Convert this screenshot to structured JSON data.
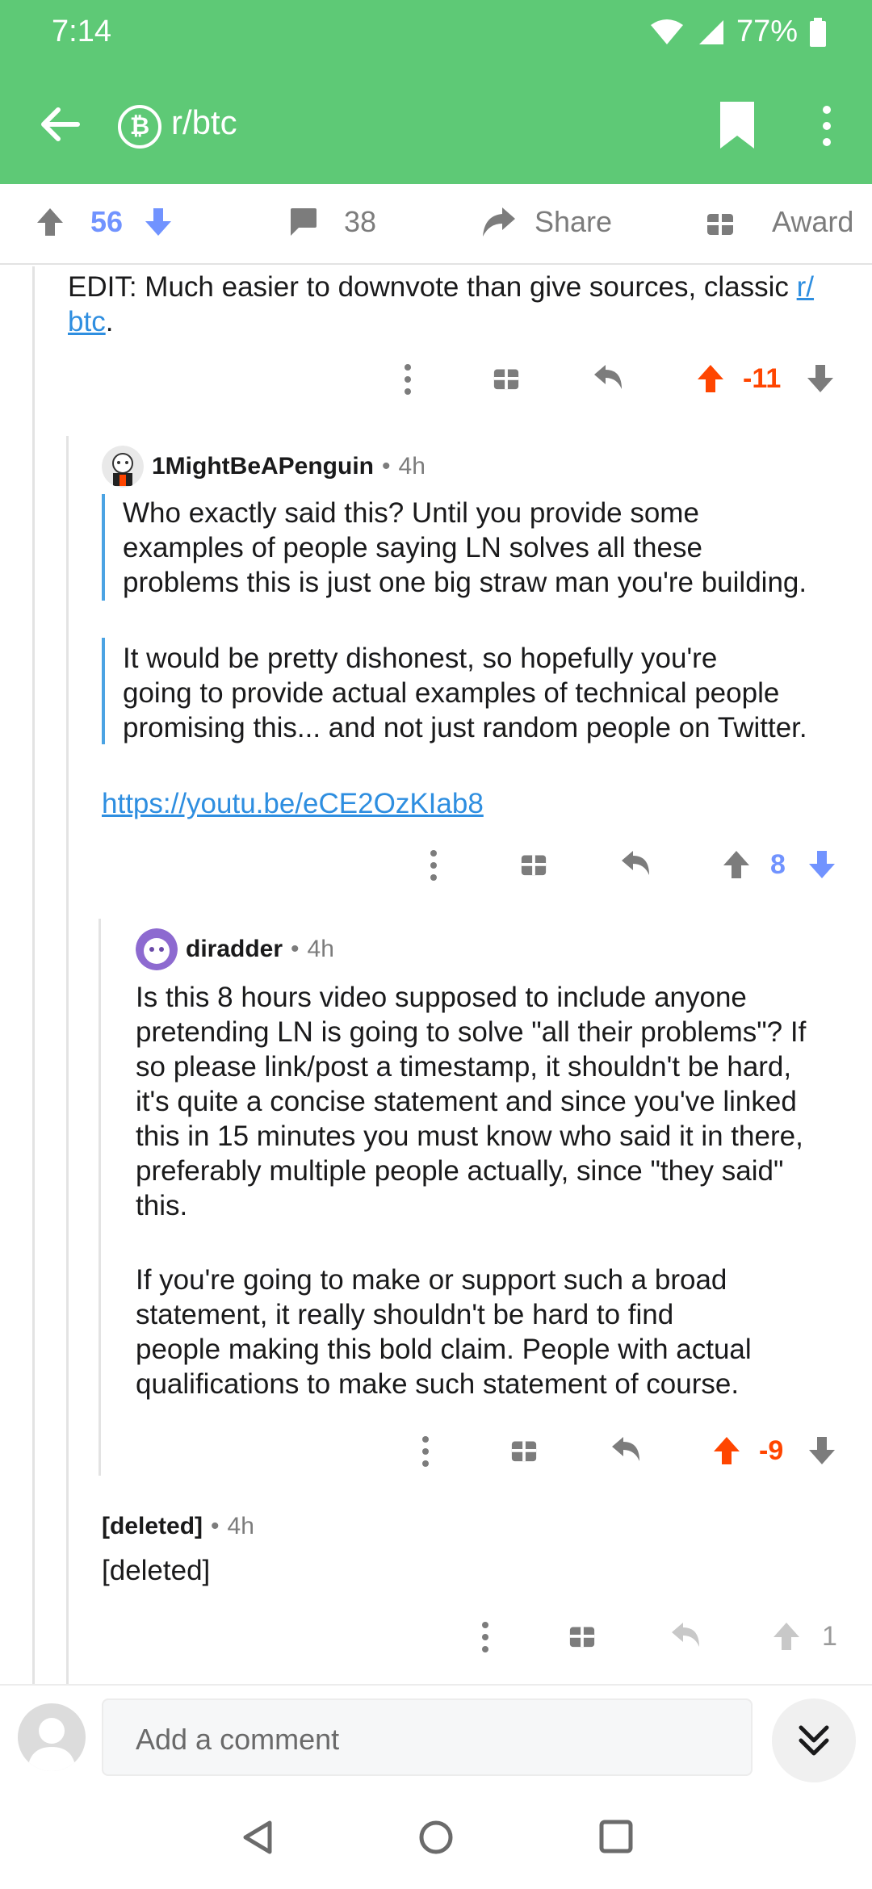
{
  "status": {
    "time": "7:14",
    "battery": "77%"
  },
  "appbar": {
    "subreddit": "r/btc",
    "sub_icon_letter": "₿"
  },
  "post_actions": {
    "score": "56",
    "comments": "38",
    "share": "Share",
    "award": "Award"
  },
  "comments": [
    {
      "text_before_link": "EDIT: Much easier to downvote than give sources, classic ",
      "link_text": "r/",
      "link_text2": "btc",
      "text_after_link": ".",
      "score": "-11"
    },
    {
      "user": "1MightBeAPenguin",
      "time": "4h",
      "quote1": [
        "Who exactly said this? Until you provide some",
        "examples of people saying LN solves all these",
        "problems this is just one big straw man you're building."
      ],
      "quote2": [
        "It would be pretty dishonest, so hopefully you're",
        "going to provide actual examples of technical people",
        "promising this... and not just random people on Twitter."
      ],
      "link": "https://youtu.be/eCE2OzKIab8",
      "score": "8"
    },
    {
      "user": "diradder",
      "time": "4h",
      "para1": [
        "Is this 8 hours video supposed to include anyone",
        "pretending LN is going to solve \"all their problems\"? If",
        "so please link/post a timestamp, it shouldn't be hard,",
        "it's quite a concise statement and since you've linked",
        "this in 15 minutes you must know who said it in there,",
        "preferably multiple people actually, since \"they said\"",
        "this."
      ],
      "para2": [
        "If you're going to make or support such a broad",
        "statement, it really shouldn't be hard to find",
        "people making this bold claim. People with actual",
        "qualifications to make such statement of course."
      ],
      "score": "-9"
    },
    {
      "user": "[deleted]",
      "time": "4h",
      "body": "[deleted]",
      "score": "1"
    }
  ],
  "separator": "•",
  "bottom": {
    "placeholder": "Add a comment"
  },
  "colors": {
    "accent": "#5ec976",
    "upvote": "#ff4500",
    "downvote": "#7193ff",
    "link": "#2e8ee0"
  },
  "icons": [
    "back-arrow-icon",
    "bitcoin-icon",
    "bookmark-icon",
    "more-vert-icon",
    "upvote-icon",
    "downvote-icon",
    "comment-icon",
    "share-icon",
    "gift-icon",
    "reply-icon",
    "chevron-double-down-icon"
  ]
}
